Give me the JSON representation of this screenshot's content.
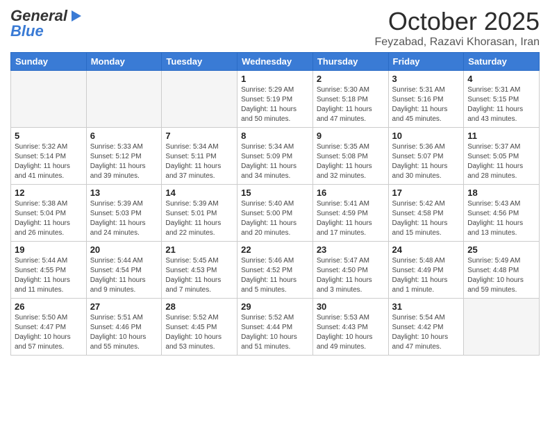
{
  "header": {
    "logo_general": "General",
    "logo_blue": "Blue",
    "title": "October 2025",
    "subtitle": "Feyzabad, Razavi Khorasan, Iran"
  },
  "weekdays": [
    "Sunday",
    "Monday",
    "Tuesday",
    "Wednesday",
    "Thursday",
    "Friday",
    "Saturday"
  ],
  "weeks": [
    {
      "cells": [
        {
          "day": null,
          "empty": true
        },
        {
          "day": null,
          "empty": true
        },
        {
          "day": null,
          "empty": true
        },
        {
          "day": "1",
          "info": "Sunrise: 5:29 AM\nSunset: 5:19 PM\nDaylight: 11 hours\nand 50 minutes."
        },
        {
          "day": "2",
          "info": "Sunrise: 5:30 AM\nSunset: 5:18 PM\nDaylight: 11 hours\nand 47 minutes."
        },
        {
          "day": "3",
          "info": "Sunrise: 5:31 AM\nSunset: 5:16 PM\nDaylight: 11 hours\nand 45 minutes."
        },
        {
          "day": "4",
          "info": "Sunrise: 5:31 AM\nSunset: 5:15 PM\nDaylight: 11 hours\nand 43 minutes."
        }
      ]
    },
    {
      "cells": [
        {
          "day": "5",
          "info": "Sunrise: 5:32 AM\nSunset: 5:14 PM\nDaylight: 11 hours\nand 41 minutes."
        },
        {
          "day": "6",
          "info": "Sunrise: 5:33 AM\nSunset: 5:12 PM\nDaylight: 11 hours\nand 39 minutes."
        },
        {
          "day": "7",
          "info": "Sunrise: 5:34 AM\nSunset: 5:11 PM\nDaylight: 11 hours\nand 37 minutes."
        },
        {
          "day": "8",
          "info": "Sunrise: 5:34 AM\nSunset: 5:09 PM\nDaylight: 11 hours\nand 34 minutes."
        },
        {
          "day": "9",
          "info": "Sunrise: 5:35 AM\nSunset: 5:08 PM\nDaylight: 11 hours\nand 32 minutes."
        },
        {
          "day": "10",
          "info": "Sunrise: 5:36 AM\nSunset: 5:07 PM\nDaylight: 11 hours\nand 30 minutes."
        },
        {
          "day": "11",
          "info": "Sunrise: 5:37 AM\nSunset: 5:05 PM\nDaylight: 11 hours\nand 28 minutes."
        }
      ]
    },
    {
      "cells": [
        {
          "day": "12",
          "info": "Sunrise: 5:38 AM\nSunset: 5:04 PM\nDaylight: 11 hours\nand 26 minutes."
        },
        {
          "day": "13",
          "info": "Sunrise: 5:39 AM\nSunset: 5:03 PM\nDaylight: 11 hours\nand 24 minutes."
        },
        {
          "day": "14",
          "info": "Sunrise: 5:39 AM\nSunset: 5:01 PM\nDaylight: 11 hours\nand 22 minutes."
        },
        {
          "day": "15",
          "info": "Sunrise: 5:40 AM\nSunset: 5:00 PM\nDaylight: 11 hours\nand 20 minutes."
        },
        {
          "day": "16",
          "info": "Sunrise: 5:41 AM\nSunset: 4:59 PM\nDaylight: 11 hours\nand 17 minutes."
        },
        {
          "day": "17",
          "info": "Sunrise: 5:42 AM\nSunset: 4:58 PM\nDaylight: 11 hours\nand 15 minutes."
        },
        {
          "day": "18",
          "info": "Sunrise: 5:43 AM\nSunset: 4:56 PM\nDaylight: 11 hours\nand 13 minutes."
        }
      ]
    },
    {
      "cells": [
        {
          "day": "19",
          "info": "Sunrise: 5:44 AM\nSunset: 4:55 PM\nDaylight: 11 hours\nand 11 minutes."
        },
        {
          "day": "20",
          "info": "Sunrise: 5:44 AM\nSunset: 4:54 PM\nDaylight: 11 hours\nand 9 minutes."
        },
        {
          "day": "21",
          "info": "Sunrise: 5:45 AM\nSunset: 4:53 PM\nDaylight: 11 hours\nand 7 minutes."
        },
        {
          "day": "22",
          "info": "Sunrise: 5:46 AM\nSunset: 4:52 PM\nDaylight: 11 hours\nand 5 minutes."
        },
        {
          "day": "23",
          "info": "Sunrise: 5:47 AM\nSunset: 4:50 PM\nDaylight: 11 hours\nand 3 minutes."
        },
        {
          "day": "24",
          "info": "Sunrise: 5:48 AM\nSunset: 4:49 PM\nDaylight: 11 hours\nand 1 minute."
        },
        {
          "day": "25",
          "info": "Sunrise: 5:49 AM\nSunset: 4:48 PM\nDaylight: 10 hours\nand 59 minutes."
        }
      ]
    },
    {
      "cells": [
        {
          "day": "26",
          "info": "Sunrise: 5:50 AM\nSunset: 4:47 PM\nDaylight: 10 hours\nand 57 minutes."
        },
        {
          "day": "27",
          "info": "Sunrise: 5:51 AM\nSunset: 4:46 PM\nDaylight: 10 hours\nand 55 minutes."
        },
        {
          "day": "28",
          "info": "Sunrise: 5:52 AM\nSunset: 4:45 PM\nDaylight: 10 hours\nand 53 minutes."
        },
        {
          "day": "29",
          "info": "Sunrise: 5:52 AM\nSunset: 4:44 PM\nDaylight: 10 hours\nand 51 minutes."
        },
        {
          "day": "30",
          "info": "Sunrise: 5:53 AM\nSunset: 4:43 PM\nDaylight: 10 hours\nand 49 minutes."
        },
        {
          "day": "31",
          "info": "Sunrise: 5:54 AM\nSunset: 4:42 PM\nDaylight: 10 hours\nand 47 minutes."
        },
        {
          "day": null,
          "empty": true
        }
      ]
    }
  ]
}
